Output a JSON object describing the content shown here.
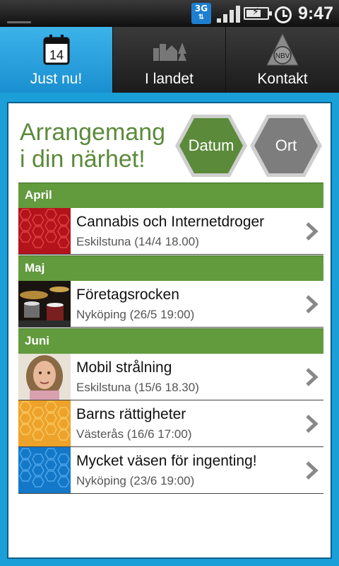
{
  "status_bar": {
    "network": "3G",
    "time": "9:47",
    "icons": [
      "3g-data-icon",
      "signal-icon",
      "battery-charging-icon",
      "alarm-icon"
    ]
  },
  "tabs": [
    {
      "label": "Just nu!",
      "icon": "calendar-icon",
      "calendar_day": "14",
      "active": true
    },
    {
      "label": "I landet",
      "icon": "town-icon",
      "active": false
    },
    {
      "label": "Kontakt",
      "icon": "nbv-logo-icon",
      "logo_text": "NBV",
      "active": false
    }
  ],
  "heading": {
    "line1": "Arrangemang",
    "line2": "i din närhet!"
  },
  "filters": [
    {
      "label": "Datum",
      "selected": true,
      "color": "#5b8a3a"
    },
    {
      "label": "Ort",
      "selected": false,
      "color": "#7d7d7d"
    }
  ],
  "sections": [
    {
      "month": "April",
      "events": [
        {
          "title": "Cannabis och Internetdroger",
          "subtitle": "Eskilstuna (14/4 18.00)",
          "thumb": "red-hexagon-pattern"
        }
      ]
    },
    {
      "month": "Maj",
      "events": [
        {
          "title": "Företagsrocken",
          "subtitle": "Nyköping (26/5 19:00)",
          "thumb": "drum-kit-photo"
        }
      ]
    },
    {
      "month": "Juni",
      "events": [
        {
          "title": "Mobil strålning",
          "subtitle": "Eskilstuna (15/6 18.30)",
          "thumb": "woman-portrait-photo"
        },
        {
          "title": "Barns rättigheter",
          "subtitle": "Västerås (16/6 17:00)",
          "thumb": "orange-hexagon-pattern"
        },
        {
          "title": "Mycket väsen för ingenting!",
          "subtitle": "Nyköping (23/6 19:00)",
          "thumb": "blue-hexagon-pattern"
        }
      ]
    }
  ],
  "colors": {
    "accent_blue": "#1a9fd9",
    "header_green": "#629a3e",
    "heading_green": "#5b8a3a"
  }
}
